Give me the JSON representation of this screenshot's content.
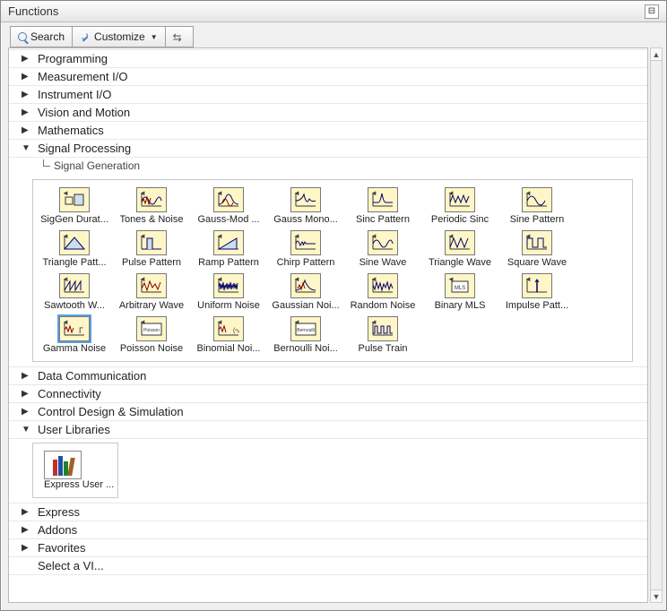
{
  "window": {
    "title": "Functions"
  },
  "toolbar": {
    "search": "Search",
    "customize": "Customize",
    "changeview_tip": "Change Visible Palettes"
  },
  "tree": {
    "items": [
      {
        "label": "Programming",
        "expanded": false
      },
      {
        "label": "Measurement I/O",
        "expanded": false
      },
      {
        "label": "Instrument I/O",
        "expanded": false
      },
      {
        "label": "Vision and Motion",
        "expanded": false
      },
      {
        "label": "Mathematics",
        "expanded": false
      },
      {
        "label": "Signal Processing",
        "expanded": true
      },
      {
        "label": "Data Communication",
        "expanded": false
      },
      {
        "label": "Connectivity",
        "expanded": false
      },
      {
        "label": "Control Design & Simulation",
        "expanded": false
      },
      {
        "label": "User Libraries",
        "expanded": true
      },
      {
        "label": "Express",
        "expanded": false
      },
      {
        "label": "Addons",
        "expanded": false
      },
      {
        "label": "Favorites",
        "expanded": false
      },
      {
        "label": "Select a VI...",
        "expanded": false
      }
    ],
    "subpath": "Signal Generation"
  },
  "palette": [
    {
      "label": "SigGen Durat...",
      "kind": "siggen"
    },
    {
      "label": "Tones & Noise",
      "kind": "tones"
    },
    {
      "label": "Gauss-Mod ...",
      "kind": "gaussmod"
    },
    {
      "label": "Gauss Mono...",
      "kind": "gaussmono"
    },
    {
      "label": "Sinc Pattern",
      "kind": "sinc"
    },
    {
      "label": "Periodic Sinc",
      "kind": "psinc"
    },
    {
      "label": "Sine Pattern",
      "kind": "sinepat"
    },
    {
      "label": "Triangle Patt...",
      "kind": "tripat"
    },
    {
      "label": "Pulse Pattern",
      "kind": "pulsepat"
    },
    {
      "label": "Ramp Pattern",
      "kind": "ramp"
    },
    {
      "label": "Chirp Pattern",
      "kind": "chirp"
    },
    {
      "label": "Sine Wave",
      "kind": "sinewave"
    },
    {
      "label": "Triangle Wave",
      "kind": "triwave"
    },
    {
      "label": "Square Wave",
      "kind": "square"
    },
    {
      "label": "Sawtooth W...",
      "kind": "saw"
    },
    {
      "label": "Arbitrary Wave",
      "kind": "arb"
    },
    {
      "label": "Uniform Noise",
      "kind": "unoise"
    },
    {
      "label": "Gaussian Noi...",
      "kind": "gnoise"
    },
    {
      "label": "Random Noise",
      "kind": "rnoise"
    },
    {
      "label": "Binary MLS",
      "kind": "mls"
    },
    {
      "label": "Impulse Patt...",
      "kind": "impulse"
    },
    {
      "label": "Gamma Noise",
      "kind": "gamma",
      "selected": true
    },
    {
      "label": "Poisson Noise",
      "kind": "poisson"
    },
    {
      "label": "Binomial Noi...",
      "kind": "binom"
    },
    {
      "label": "Bernoulli Noi...",
      "kind": "bern"
    },
    {
      "label": "Pulse Train",
      "kind": "ptrain"
    }
  ],
  "userlib": {
    "label": "Express User ..."
  }
}
